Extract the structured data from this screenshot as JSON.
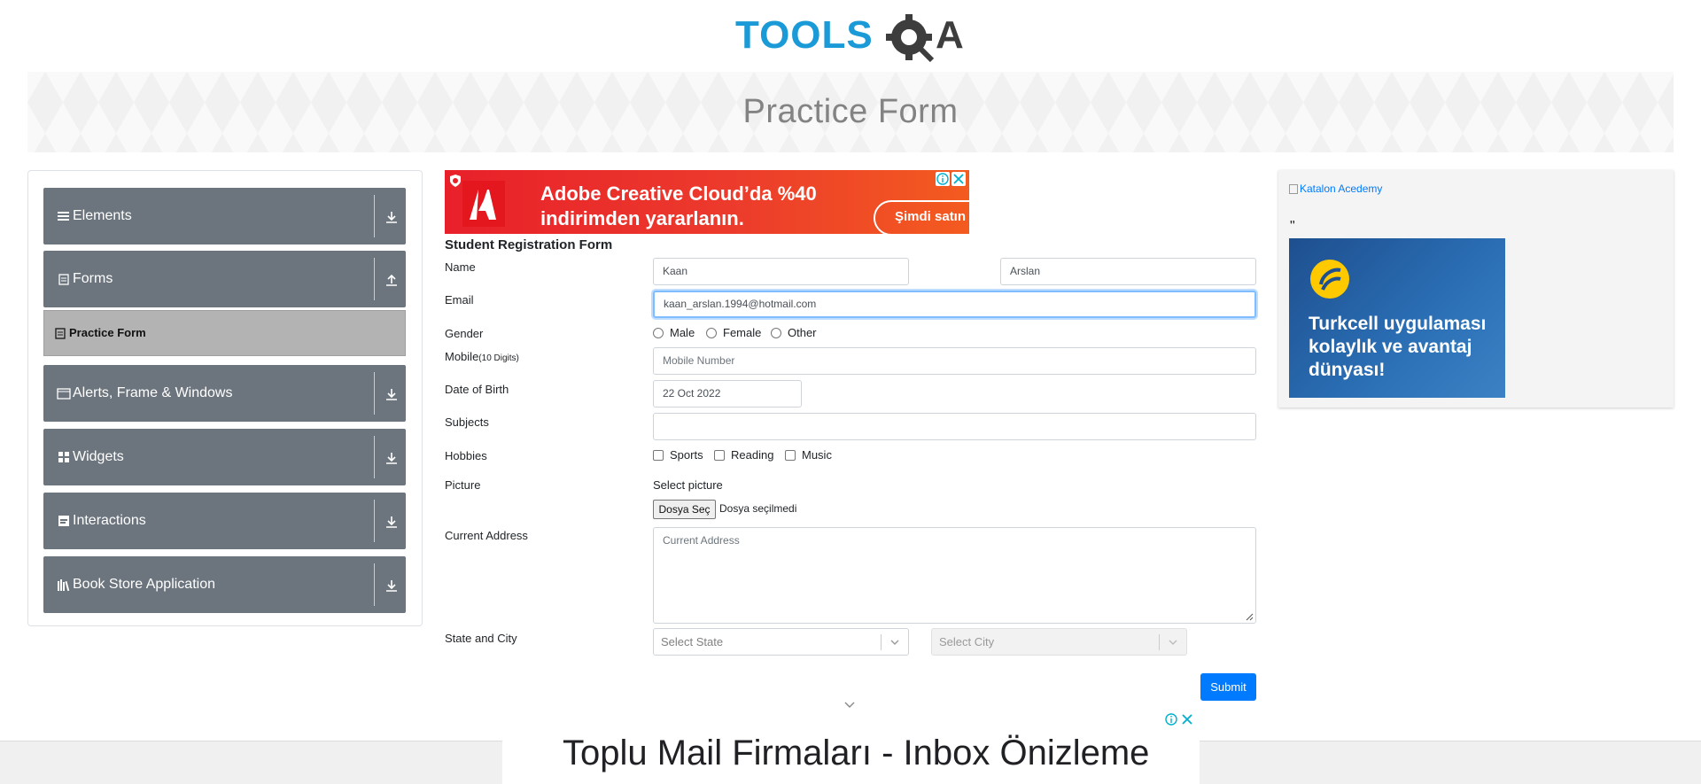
{
  "header": {
    "logo_text": "TOOLSQA",
    "page_title": "Practice Form"
  },
  "sidebar": {
    "groups": [
      {
        "label": "Elements",
        "icon": "hamburger-icon",
        "arrow": "download-icon"
      },
      {
        "label": "Forms",
        "icon": "form-icon",
        "arrow": "upload-icon"
      },
      {
        "label": "Alerts, Frame & Windows",
        "icon": "window-icon",
        "arrow": "download-icon"
      },
      {
        "label": "Widgets",
        "icon": "widgets-icon",
        "arrow": "download-icon"
      },
      {
        "label": "Interactions",
        "icon": "interactions-icon",
        "arrow": "download-icon"
      },
      {
        "label": "Book Store Application",
        "icon": "books-icon",
        "arrow": "download-icon"
      }
    ],
    "active_item": "Practice Form"
  },
  "ad_top": {
    "line1": "Adobe Creative Cloud’da %40",
    "line2": "indirimden yararlanın.",
    "cta": "Şimdi satın"
  },
  "form": {
    "heading": "Student Registration Form",
    "name_label": "Name",
    "first_name": "Kaan",
    "last_name": "Arslan",
    "email_label": "Email",
    "email_value": "kaan_arslan.1994@hotmail.com",
    "gender_label": "Gender",
    "gender_options": [
      "Male",
      "Female",
      "Other"
    ],
    "mobile_label": "Mobile",
    "mobile_hint": "(10 Digits)",
    "mobile_placeholder": "Mobile Number",
    "dob_label": "Date of Birth",
    "dob_value": "22 Oct 2022",
    "subjects_label": "Subjects",
    "hobbies_label": "Hobbies",
    "hobbies_options": [
      "Sports",
      "Reading",
      "Music"
    ],
    "picture_label": "Picture",
    "select_picture": "Select picture",
    "file_button": "Dosya Seç",
    "file_none": "Dosya seçilmedi",
    "address_label": "Current Address",
    "address_placeholder": "Current Address",
    "state_city_label": "State and City",
    "state_placeholder": "Select State",
    "city_placeholder": "Select City",
    "submit_label": "Submit"
  },
  "right_ad": {
    "katalon_alt": "Katalon Acedemy",
    "quote": "\"",
    "turkcell_lines": [
      "Turkcell uygulaması",
      "kolaylık ve avantaj",
      "dünyası!"
    ]
  },
  "ad_bottom": {
    "headline": "Toplu Mail Firmaları - Inbox Önizleme"
  },
  "colors": {
    "primary": "#007bff",
    "sidebar_group": "#6c757d",
    "active_item": "#b3b3b3",
    "logo_blue": "#1a9ad6"
  }
}
